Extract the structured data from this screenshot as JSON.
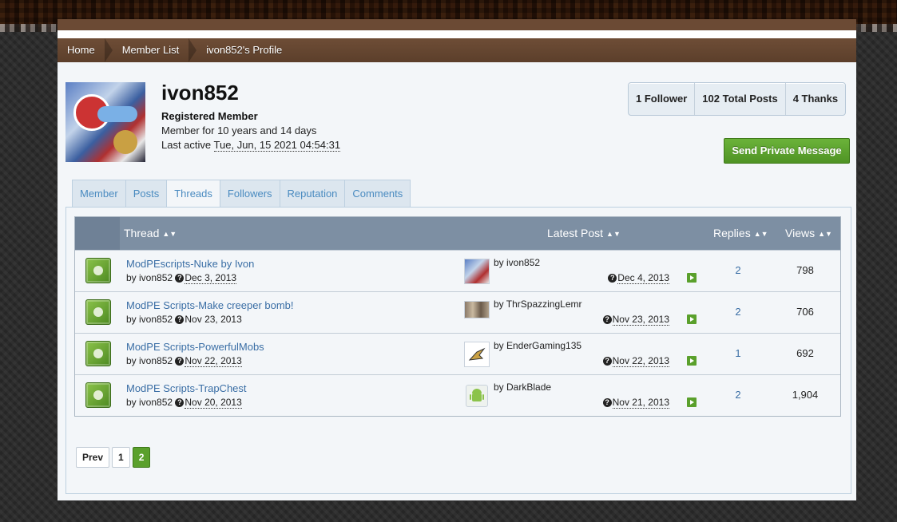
{
  "breadcrumbs": [
    "Home",
    "Member List",
    "ivon852's Profile"
  ],
  "profile": {
    "username": "ivon852",
    "rank": "Registered Member",
    "member_for": "Member for 10 years and 14 days",
    "last_active_label": "Last active",
    "last_active_date": "Tue, Jun, 15 2021 04:54:31"
  },
  "stats": [
    "1 Follower",
    "102 Total Posts",
    "4 Thanks"
  ],
  "pm_button": "Send Private Message",
  "tabs": [
    "Member",
    "Posts",
    "Threads",
    "Followers",
    "Reputation",
    "Comments"
  ],
  "active_tab": "Threads",
  "columns": {
    "thread": "Thread",
    "latest": "Latest Post",
    "replies": "Replies",
    "views": "Views"
  },
  "threads": [
    {
      "title": "ModPEscripts-Nuke by Ivon",
      "by": "by ivon852",
      "date": "Dec 3, 2013",
      "last_by": "by ivon852",
      "last_date": "Dec 4, 2013",
      "replies": "2",
      "views": "798"
    },
    {
      "title": "ModPE Scripts-Make creeper bomb!",
      "by": "by ivon852",
      "date": "Nov 23, 2013",
      "last_by": "by ThrSpazzingLemr",
      "last_date": "Nov 23, 2013",
      "replies": "2",
      "views": "706"
    },
    {
      "title": "ModPE Scripts-PowerfulMobs",
      "by": "by ivon852",
      "date": "Nov 22, 2013",
      "last_by": "by EnderGaming135",
      "last_date": "Nov 22, 2013",
      "replies": "1",
      "views": "692"
    },
    {
      "title": "ModPE Scripts-TrapChest",
      "by": "by ivon852",
      "date": "Nov 20, 2013",
      "last_by": "by DarkBlade",
      "last_date": "Nov 21, 2013",
      "replies": "2",
      "views": "1,904"
    }
  ],
  "pagination": {
    "prev": "Prev",
    "pages": [
      "1",
      "2"
    ],
    "current": "2"
  },
  "colors": {
    "brown": "#6b4a34",
    "accent_green": "#5aa02c",
    "header_blue": "#7d8fa3",
    "link": "#3a6ea5"
  }
}
